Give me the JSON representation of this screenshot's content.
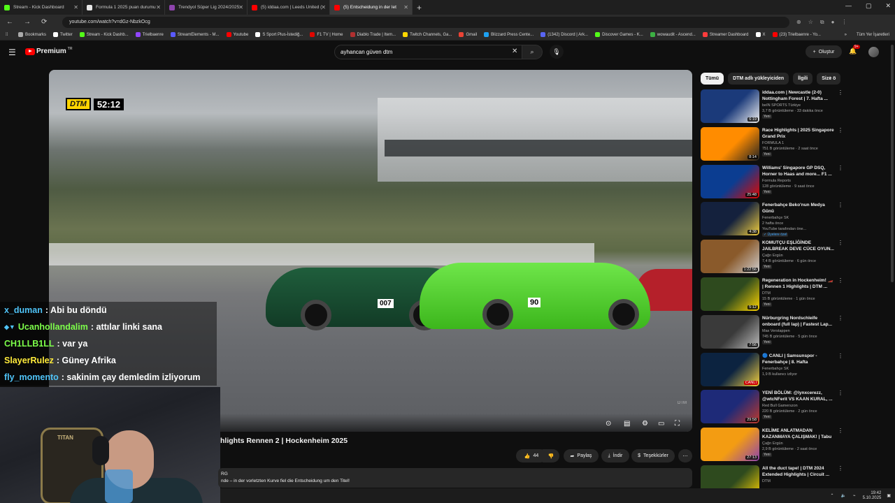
{
  "browser": {
    "tabs": [
      {
        "label": "Stream - Kick Dashboard",
        "color": "#53fc18"
      },
      {
        "label": "Formula 1 2025 puan durumu",
        "color": "#e6e6e6"
      },
      {
        "label": "Trendyol Süper Lig 2024/2025",
        "color": "#8e44ad"
      },
      {
        "label": "(5) iddaa.com | Leeds United (",
        "color": "#ff0000"
      },
      {
        "label": "(5) Entscheidung in der let",
        "color": "#ff0000"
      }
    ],
    "url": "youtube.com/watch?v=dGz-NbzkOcg",
    "bookmarks": [
      {
        "label": "Bookmarks",
        "color": "#aaaaaa"
      },
      {
        "label": "Twitter",
        "color": "#ffffff"
      },
      {
        "label": "Stream - Kick Dashb...",
        "color": "#53fc18"
      },
      {
        "label": "Trielbaenre",
        "color": "#9146ff"
      },
      {
        "label": "StreamElements - M...",
        "color": "#5a5aff"
      },
      {
        "label": "Youtube",
        "color": "#ff0000"
      },
      {
        "label": "S Sport Plus-İstediğ...",
        "color": "#ffffff"
      },
      {
        "label": "F1 TV | Home",
        "color": "#e10600"
      },
      {
        "label": "Diablo Trade | Item...",
        "color": "#b03030"
      },
      {
        "label": "Twitch Channels, Ga...",
        "color": "#ffd700"
      },
      {
        "label": "Gmail",
        "color": "#ea4335"
      },
      {
        "label": "Blizzard Press Cente...",
        "color": "#1da1f2"
      },
      {
        "label": "(1342) Discord | Ark...",
        "color": "#5865f2"
      },
      {
        "label": "Discover Games - K...",
        "color": "#53fc18"
      },
      {
        "label": "wowaudit - Ascend...",
        "color": "#3cb043"
      },
      {
        "label": "Streamer Dashboard",
        "color": "#ff3c3c"
      },
      {
        "label": "X",
        "color": "#ffffff"
      },
      {
        "label": "(23) Trielbaenre - Yo...",
        "color": "#ff0000"
      }
    ],
    "bookmarks_more": "»",
    "all_bookmarks": "Tüm Yer İşaretleri"
  },
  "youtube": {
    "logo_text": "Premium",
    "logo_region": "TR",
    "search_value": "ayhancan güven dtm",
    "create_label": "Oluştur",
    "notif_count": "9+"
  },
  "video": {
    "scorebug_logo": "DTM",
    "scorebug_time": "52:12",
    "car1_number": "007",
    "car2_number": "90",
    "watermark": "DTM",
    "title": "hlights Rennen 2 | Hockenheim 2025",
    "likes": "44",
    "share_label": "Paylaş",
    "download_label": "İndir",
    "thanks_label": "Teşekkürler",
    "desc_line1": "RG",
    "desc_line2": "nde – in der vorletzten Kurve fiel die Entscheidung um den Titel!"
  },
  "chat": [
    {
      "user": "x_duman",
      "color": "#4fc3f7",
      "msg": ": Abi bu döndü",
      "badge": ""
    },
    {
      "user": "Ucanhollandalim",
      "color": "#7dff4a",
      "msg": ": attılar linki sana",
      "badge": "◆▼"
    },
    {
      "user": "CH1LLB1LL",
      "color": "#7dff4a",
      "msg": ": var ya",
      "badge": ""
    },
    {
      "user": "SlayerRulez",
      "color": "#ffeb3b",
      "msg": ": Güney Afrika",
      "badge": ""
    },
    {
      "user": "fly_momento",
      "color": "#4fc3f7",
      "msg": ": sakinim çay demledim izliyorum",
      "badge": ""
    }
  ],
  "webcam": {
    "chair_brand": "TITAN"
  },
  "chips": [
    "Tümü",
    "DTM adlı yükleyiciden",
    "İlgili",
    "Size ö"
  ],
  "recommendations": [
    {
      "title": "iddaa.com | Newcastle (2-0) Nottingham Forest | 7. Hafta ...",
      "channel": "beIN SPORTS Türkiye",
      "meta": "3,7 B görüntüleme · 33 dakika önce",
      "badge": "Yeni",
      "duration": "6:19",
      "c1": "#1b3a7a",
      "c2": "#f0f0f0"
    },
    {
      "title": "Race Highlights | 2025 Singapore Grand Prix",
      "channel": "FORMULA 1",
      "meta": "751 B görüntüleme · 2 saat önce",
      "badge": "Yeni",
      "duration": "8:14",
      "c1": "#ff8c00",
      "c2": "#222222"
    },
    {
      "title": "Williams' Singapore GP DSQ, Horner to Haas and more... F1 ...",
      "channel": "Formula Reports",
      "meta": "128 görüntüleme · 9 saat önce",
      "badge": "Yeni",
      "duration": "25:48",
      "c1": "#0b3d91",
      "c2": "#e10600"
    },
    {
      "title": "Fenerbahçe Beko'nun Medya Günü",
      "channel": "Fenerbahçe SK",
      "meta": "2 hafta önce",
      "badge": "✓ Üyelere özel",
      "extra": "YouTube tarafından öne...",
      "duration": "4:38",
      "c1": "#14213d",
      "c2": "#f4d03f"
    },
    {
      "title": "KOMUTÇU EŞLİĞİNDE JAILBREAK DEVE CÜCE OYUN...",
      "channel": "Çağrı Ergün",
      "meta": "7,4 B görüntüleme · 6 gün önce",
      "badge": "Yeni",
      "duration": "1:22:56",
      "c1": "#8a5a2b",
      "c2": "#d0d0d0"
    },
    {
      "title": "Regeneration in Hockenheim! 🏎️ | Rennen 1 Highlights | DTM ...",
      "channel": "DTM",
      "meta": "15 B görüntüleme · 1 gün önce",
      "badge": "Yeni",
      "duration": "5:12",
      "c1": "#2e4a1e",
      "c2": "#ffd400"
    },
    {
      "title": "Nürburgring Nordschleife onboard (full lap) | Fastest Lap...",
      "channel": "Max Verstappen",
      "meta": "745 B görüntüleme · 5 gün önce",
      "badge": "Yeni",
      "duration": "7:56",
      "c1": "#3a3a3a",
      "c2": "#bbbbbb"
    },
    {
      "title": "🔵 CANLI | Samsunspor - Fenerbahçe | 8. Hafta",
      "channel": "Fenerbahçe SK",
      "meta": "1,9 B kullanıcı izliyor",
      "badge": "",
      "duration": "CANLI",
      "c1": "#0c2340",
      "c2": "#f4d03f"
    },
    {
      "title": "YENİ BÖLÜM: @lynxcerezz, @wtcNFerit VS KAAN KURAL, ...",
      "channel": "Red Bull Gamerszon",
      "meta": "220 B görüntüleme · 2 gün önce",
      "badge": "Yeni",
      "duration": "29:58",
      "c1": "#1e2a78",
      "c2": "#c0392b"
    },
    {
      "title": "KELİME ANLATMADAN KAZANMAYA ÇALIŞMAK! | Tabu",
      "channel": "Çağrı Ergün",
      "meta": "2,9 B görüntüleme · 2 saat önce",
      "badge": "Yeni",
      "duration": "27:13",
      "c1": "#f39c12",
      "c2": "#8e44ad"
    },
    {
      "title": "All the duct tape! | DTM 2024 Extended Highlights | Circuit ...",
      "channel": "DTM",
      "meta": "",
      "badge": "",
      "duration": "",
      "c1": "#2e4a1e",
      "c2": "#ffd400"
    }
  ],
  "taskbar": {
    "time": "19:42",
    "date": "5.10.2025"
  }
}
